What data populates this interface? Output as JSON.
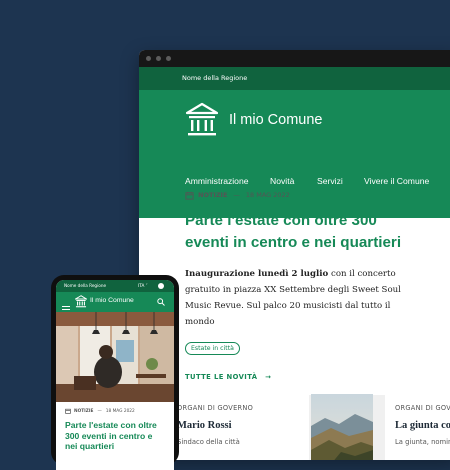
{
  "desktop": {
    "region_name": "Nome della Regione",
    "site_name": "Il mio Comune",
    "nav": [
      "Amministrazione",
      "Novità",
      "Servizi",
      "Vivere il Comune"
    ],
    "article": {
      "category": "NOTIZIE",
      "date": "18 MAG 2022",
      "title": "Parte l'estate con oltre 300 eventi in centro e nei quartieri",
      "lead_bold": "Inaugurazione lunedì 2 luglio",
      "lead_rest": " con il concerto gratuito in piazza XX Settembre degli Sweet Soul Music Revue. Sul palco 20 musicisti dal tutto il mondo",
      "tag": "Estate in città",
      "all_news": "TUTTE LE NOVITÀ"
    },
    "cards": [
      {
        "label": "ORGANI DI GOVERNO",
        "name": "Mario Rossi",
        "sub": "Sindaco della città"
      },
      {
        "label": "ORGANI DI GOVER",
        "name": "La giunta com",
        "sub": "La giunta, nomina"
      }
    ]
  },
  "mobile": {
    "region_name": "Nome della Regione",
    "language": "ITA",
    "site_name": "Il mio Comune",
    "article": {
      "category": "NOTIZIE",
      "date": "18 MAG 2022",
      "title": "Parte l'estate con oltre 300 eventi in centro e nei quartieri"
    }
  },
  "colors": {
    "background": "#1d3450",
    "primary": "#168957",
    "primary_dark": "#10633e"
  }
}
